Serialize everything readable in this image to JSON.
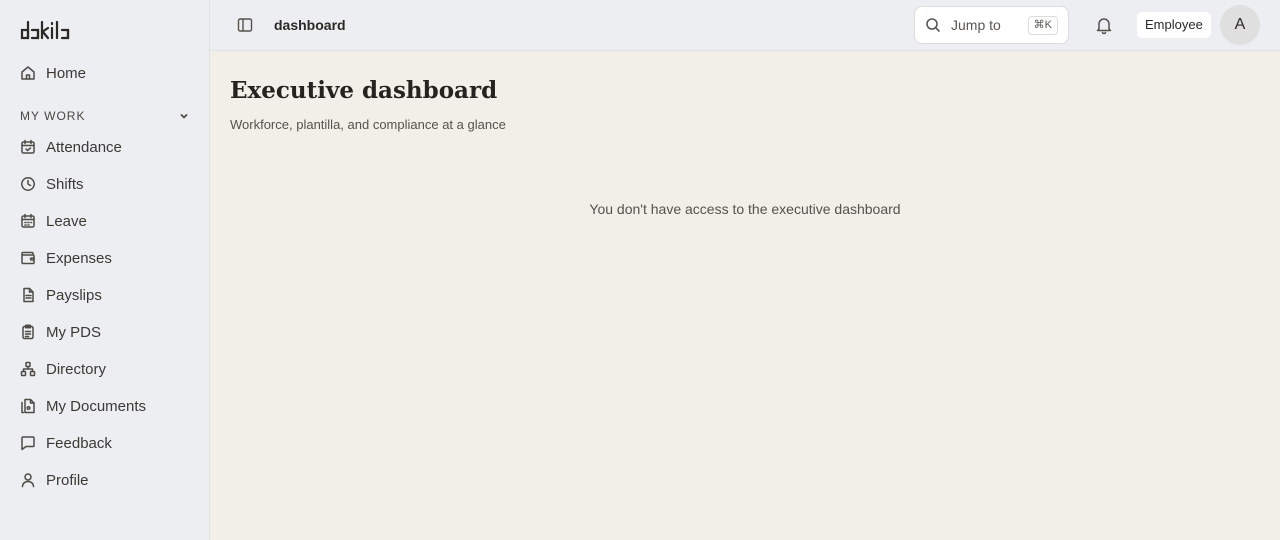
{
  "brand": {
    "logo_text": "dakila"
  },
  "sidebar": {
    "home": {
      "label": "Home",
      "icon": "home-icon"
    },
    "section": {
      "label": "MY WORK",
      "icon": "chevron-down-icon"
    },
    "items": [
      {
        "label": "Attendance",
        "icon": "calendar-check-icon"
      },
      {
        "label": "Shifts",
        "icon": "clock-icon"
      },
      {
        "label": "Leave",
        "icon": "calendar-icon"
      },
      {
        "label": "Expenses",
        "icon": "wallet-icon"
      },
      {
        "label": "Payslips",
        "icon": "document-icon"
      },
      {
        "label": "My PDS",
        "icon": "clipboard-icon"
      },
      {
        "label": "Directory",
        "icon": "org-chart-icon"
      },
      {
        "label": "My Documents",
        "icon": "file-stack-icon"
      },
      {
        "label": "Feedback",
        "icon": "message-square-icon"
      },
      {
        "label": "Profile",
        "icon": "user-icon"
      }
    ]
  },
  "topbar": {
    "breadcrumb": "dashboard",
    "search_label": "Jump to",
    "shortcut": "⌘K",
    "role_label": "Employee",
    "avatar_initial": "A"
  },
  "main": {
    "title": "Executive dashboard",
    "subtitle": "Workforce, plantilla, and compliance at a glance",
    "empty_message": "You don't have access to the executive dashboard"
  },
  "colors": {
    "sidebar_bg": "#eceef1",
    "content_bg": "#f2eee8",
    "text_primary": "#2a2723"
  }
}
